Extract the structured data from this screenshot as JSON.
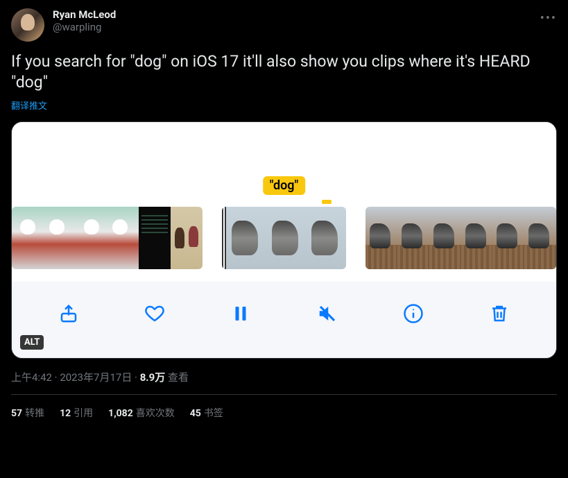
{
  "user": {
    "display_name": "Ryan McLeod",
    "handle": "@warpling"
  },
  "tweet_text": "If you search for \"dog\" on iOS 17 it'll also show you clips where it's HEARD \"dog\"",
  "translate_label": "翻译推文",
  "media": {
    "search_label": "\"dog\"",
    "alt_badge": "ALT"
  },
  "meta": {
    "time": "上午4:42",
    "sep1": " · ",
    "date": "2023年7月17日",
    "sep2": " · ",
    "views_count": "8.9万",
    "views_label": " 查看"
  },
  "stats": {
    "retweets": {
      "count": "57",
      "label": "转推"
    },
    "quotes": {
      "count": "12",
      "label": "引用"
    },
    "likes": {
      "count": "1,082",
      "label": "喜欢次数"
    },
    "bookmarks": {
      "count": "45",
      "label": "书签"
    }
  }
}
